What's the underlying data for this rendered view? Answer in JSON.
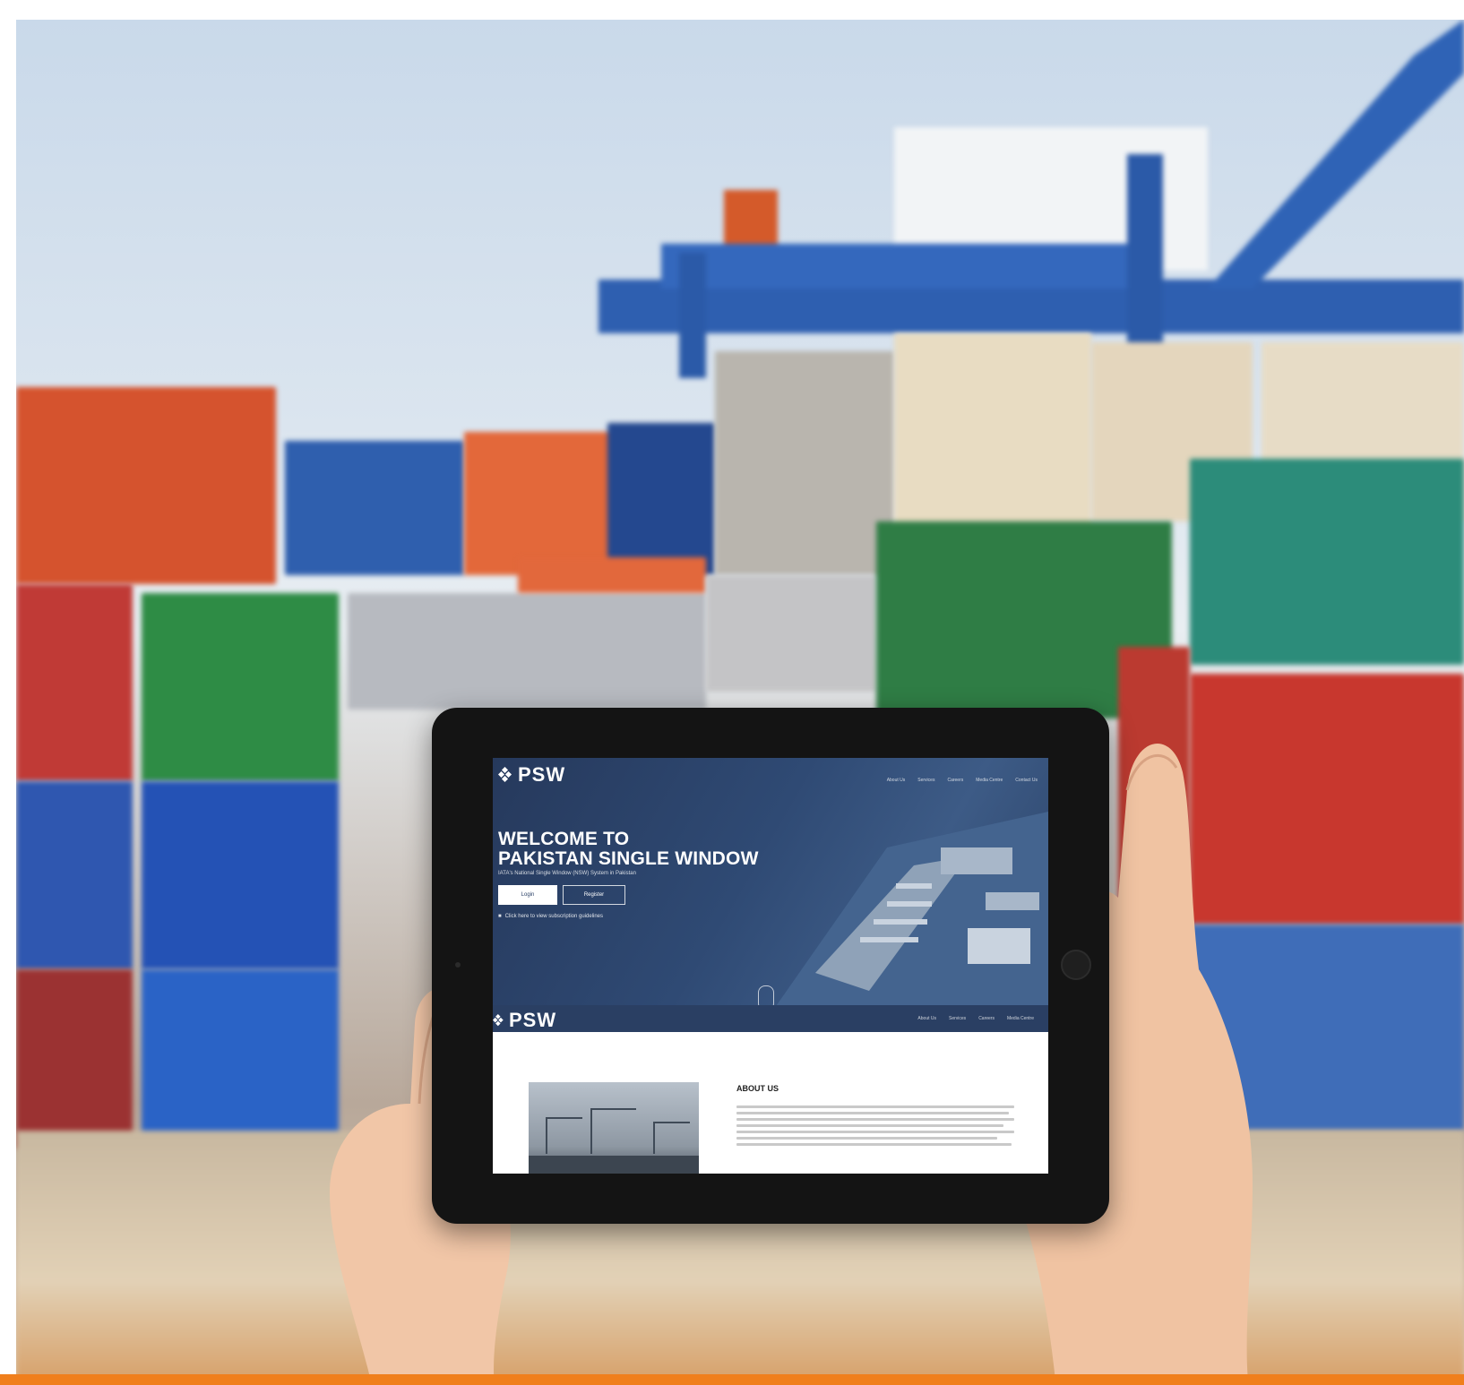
{
  "tablet_site": {
    "logo": "PSW",
    "nav": [
      "About Us",
      "Services",
      "Careers",
      "Media Centre",
      "Contact Us"
    ],
    "welcome_line1": "WELCOME TO",
    "welcome_line2": "PAKISTAN SINGLE WINDOW",
    "tagline": "IATA's National Single Window (NSW) System in Pakistan",
    "login_label": "Login",
    "register_label": "Register",
    "guidelines_text": "Click here to view subscription guidelines",
    "about_title": "ABOUT US"
  },
  "colors": {
    "brand_navy": "#2c4268",
    "accent_orange": "#f07f1c"
  }
}
